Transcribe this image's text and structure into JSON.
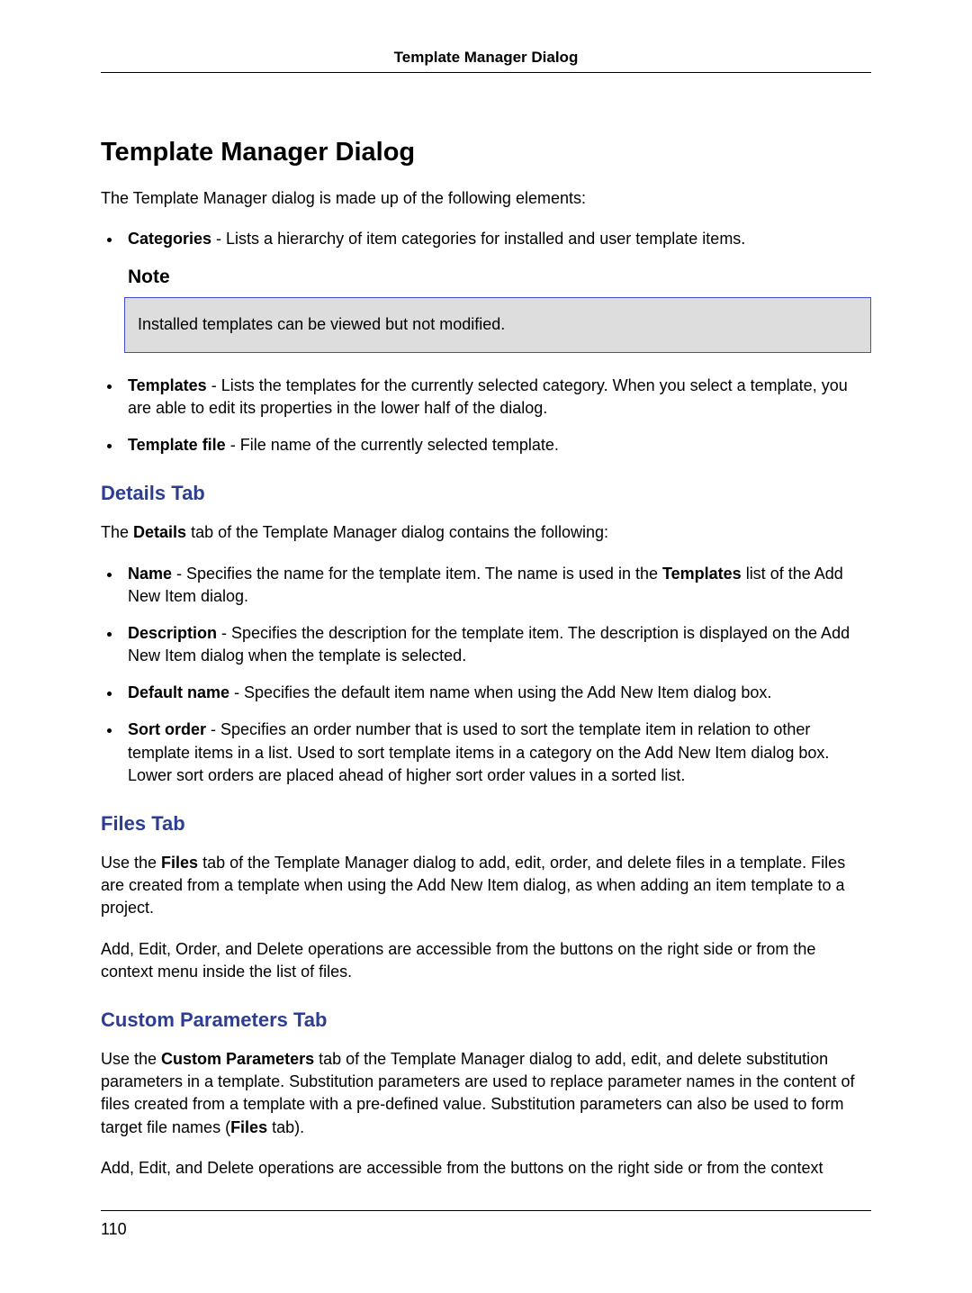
{
  "running_head": "Template Manager Dialog",
  "title": "Template Manager Dialog",
  "intro": "The Template Manager dialog is made up of the following elements:",
  "top_list_1": [
    {
      "term": "Categories",
      "desc": " - Lists a hierarchy of item categories for installed and user template items."
    }
  ],
  "note": {
    "label": "Note",
    "text": "Installed templates can be viewed but not modified."
  },
  "top_list_2": [
    {
      "term": "Templates",
      "desc": " - Lists the templates for the currently selected category. When you select a template, you are able to edit its properties in the lower half of the dialog."
    },
    {
      "term": "Template file",
      "desc": " - File name of the currently selected template."
    }
  ],
  "sections": {
    "details": {
      "heading": "Details Tab",
      "intro_pre": "The ",
      "intro_bold": "Details",
      "intro_post": " tab of the Template Manager dialog contains the following:",
      "items": [
        {
          "term": "Name",
          "desc_pre": " - Specifies the name for the template item. The name is used in the ",
          "desc_bold": "Templates",
          "desc_post": " list of the Add New Item dialog."
        },
        {
          "term": "Description",
          "desc": " - Specifies the description for the template item. The description is displayed on the Add New Item dialog when the template is selected."
        },
        {
          "term": "Default name",
          "desc": " - Specifies the default item name when using the Add New Item dialog box."
        },
        {
          "term": "Sort order",
          "desc": " - Specifies an order number that is used to sort the template item in relation to other template items in a list. Used to sort template items in a category on the Add New Item dialog box. Lower sort orders are placed ahead of higher sort order values in a sorted list."
        }
      ]
    },
    "files": {
      "heading": "Files Tab",
      "p1_pre": "Use the ",
      "p1_bold": "Files",
      "p1_post": " tab of the Template Manager dialog to add, edit, order, and delete files in a template. Files are created from a template when using the Add New Item dialog, as when adding an item template to a project.",
      "p2": "Add, Edit, Order, and Delete operations are accessible from the buttons on the right side or from the context menu inside the list of files."
    },
    "custom": {
      "heading": "Custom Parameters Tab",
      "p1_pre": "Use the ",
      "p1_bold1": "Custom Parameters",
      "p1_mid": " tab of the Template Manager dialog to add, edit, and delete substitution parameters in a template. Substitution parameters are used to replace parameter names in the content of files created from a template with a pre-defined value. Substitution parameters can also be used to form target file names (",
      "p1_bold2": "Files",
      "p1_post": " tab).",
      "p2": "Add, Edit, and Delete operations are accessible from the buttons on the right side or from the context"
    }
  },
  "page_number": "110"
}
